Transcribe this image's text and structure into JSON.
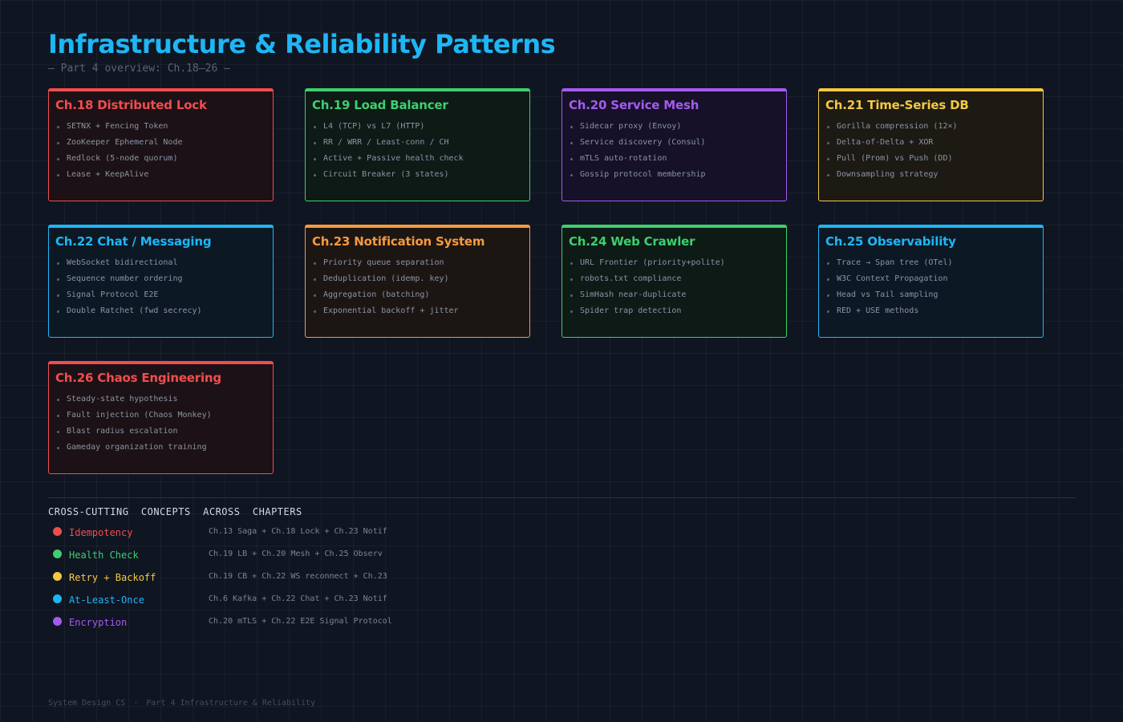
{
  "header": {
    "title": "Infrastructure & Reliability Patterns",
    "subtitle": "— Part 4 overview: Ch.18–26 —"
  },
  "cards": [
    {
      "title": "Ch.18 Distributed Lock",
      "color": "#ef4e4e",
      "bg": "#1c1116",
      "items": [
        "SETNX + Fencing Token",
        "ZooKeeper Ephemeral Node",
        "Redlock (5-node quorum)",
        "Lease + KeepAlive"
      ]
    },
    {
      "title": "Ch.19 Load Balancer",
      "color": "#3ecf6e",
      "bg": "#0d1a16",
      "items": [
        "L4 (TCP) vs L7 (HTTP)",
        "RR / WRR / Least-conn / CH",
        "Active + Passive health check",
        "Circuit Breaker (3 states)"
      ]
    },
    {
      "title": "Ch.20 Service Mesh",
      "color": "#a55bf0",
      "bg": "#161128",
      "items": [
        "Sidecar proxy (Envoy)",
        "Service discovery (Consul)",
        "mTLS auto-rotation",
        "Gossip protocol membership"
      ]
    },
    {
      "title": "Ch.21 Time-Series DB",
      "color": "#f5c842",
      "bg": "#1c1a13",
      "items": [
        "Gorilla compression (12×)",
        "Delta-of-Delta + XOR",
        "Pull (Prom) vs Push (DD)",
        "Downsampling strategy"
      ]
    },
    {
      "title": "Ch.22 Chat / Messaging",
      "color": "#1eb6f5",
      "bg": "#0c1824",
      "items": [
        "WebSocket bidirectional",
        "Sequence number ordering",
        "Signal Protocol E2E",
        "Double Ratchet (fwd secrecy)"
      ]
    },
    {
      "title": "Ch.23 Notification System",
      "color": "#f59a3e",
      "bg": "#1c1613",
      "items": [
        "Priority queue separation",
        "Deduplication (idemp. key)",
        "Aggregation (batching)",
        "Exponential backoff + jitter"
      ]
    },
    {
      "title": "Ch.24 Web Crawler",
      "color": "#3ecf6e",
      "bg": "#0d1a16",
      "items": [
        "URL Frontier (priority+polite)",
        "robots.txt compliance",
        "SimHash near-duplicate",
        "Spider trap detection"
      ]
    },
    {
      "title": "Ch.25 Observability",
      "color": "#1eb6f5",
      "bg": "#0c1824",
      "items": [
        "Trace → Span tree (OTel)",
        "W3C Context Propagation",
        "Head vs Tail sampling",
        "RED + USE methods"
      ]
    },
    {
      "title": "Ch.26 Chaos Engineering",
      "color": "#ef4e4e",
      "bg": "#1c1116",
      "items": [
        "Steady-state hypothesis",
        "Fault injection (Chaos Monkey)",
        "Blast radius escalation",
        "Gameday organization training"
      ]
    }
  ],
  "cross_cutting": {
    "title": "CROSS-CUTTING  CONCEPTS  ACROSS  CHAPTERS",
    "rows": [
      {
        "name": "Idempotency",
        "color": "#ef4e4e",
        "chapters": "Ch.13 Saga + Ch.18 Lock + Ch.23 Notif"
      },
      {
        "name": "Health Check",
        "color": "#3ecf6e",
        "chapters": "Ch.19 LB + Ch.20 Mesh + Ch.25 Observ"
      },
      {
        "name": "Retry + Backoff",
        "color": "#f5c842",
        "chapters": "Ch.19 CB + Ch.22 WS reconnect + Ch.23"
      },
      {
        "name": "At-Least-Once",
        "color": "#1eb6f5",
        "chapters": "Ch.6 Kafka + Ch.22 Chat + Ch.23 Notif"
      },
      {
        "name": "Encryption",
        "color": "#a55bf0",
        "chapters": "Ch.20 mTLS + Ch.22 E2E Signal Protocol"
      }
    ]
  },
  "footer": {
    "left": "System Design CS",
    "separator": "·",
    "right": "Part 4 Infrastructure & Reliability"
  }
}
